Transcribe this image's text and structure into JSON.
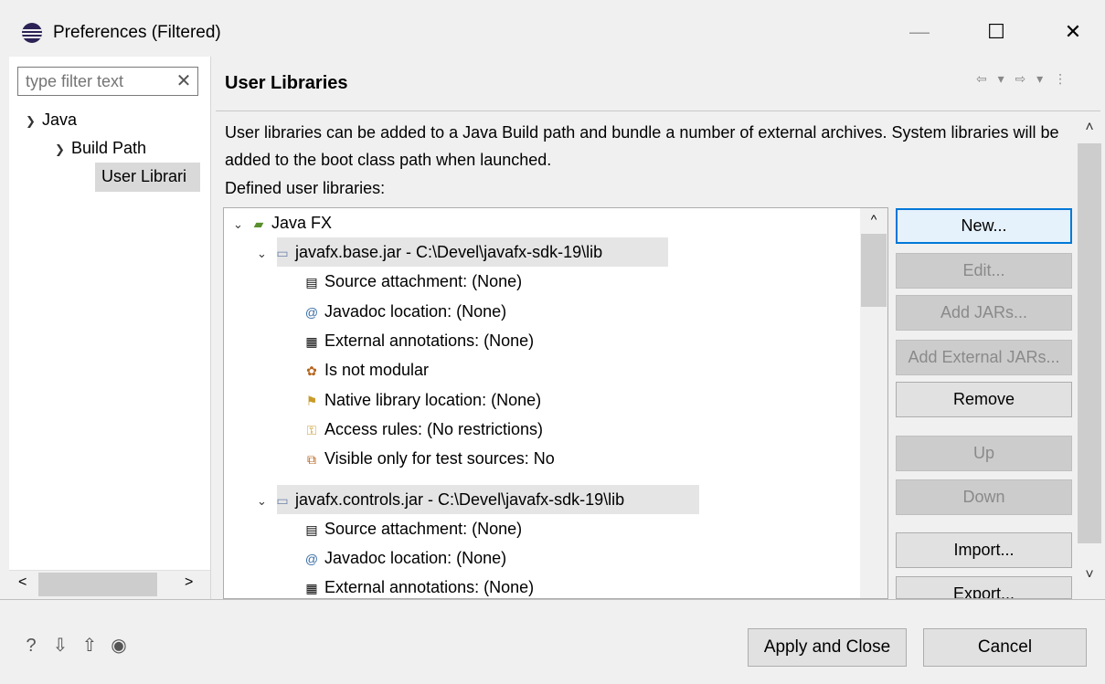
{
  "window": {
    "title": "Preferences (Filtered)",
    "minimize_icon": "—",
    "maximize_icon": "☐",
    "close_icon": "✕"
  },
  "left": {
    "filter_placeholder": "type filter text",
    "tree": [
      {
        "label": "Java"
      },
      {
        "label": "Build Path"
      },
      {
        "label": "User Librari"
      }
    ]
  },
  "page": {
    "title": "User Libraries",
    "description": "User libraries can be added to a Java Build path and bundle a number of external archives. System libraries will be added to the boot class path when launched.",
    "defined_label": "Defined user libraries:"
  },
  "libraries": {
    "root": "Java FX",
    "jars": [
      {
        "label": "javafx.base.jar - C:\\Devel\\javafx-sdk-19\\lib",
        "children": [
          {
            "icon": "source-attachment-icon",
            "label": "Source attachment: (None)"
          },
          {
            "icon": "javadoc-icon",
            "label": "Javadoc location: (None)"
          },
          {
            "icon": "annotations-icon",
            "label": "External annotations: (None)"
          },
          {
            "icon": "modular-icon",
            "label": "Is not modular"
          },
          {
            "icon": "native-library-icon",
            "label": "Native library location: (None)"
          },
          {
            "icon": "access-rules-icon",
            "label": "Access rules: (No restrictions)"
          },
          {
            "icon": "test-sources-icon",
            "label": "Visible only for test sources: No"
          }
        ]
      },
      {
        "label": "javafx.controls.jar - C:\\Devel\\javafx-sdk-19\\lib",
        "children": [
          {
            "icon": "source-attachment-icon",
            "label": "Source attachment: (None)"
          },
          {
            "icon": "javadoc-icon",
            "label": "Javadoc location: (None)"
          },
          {
            "icon": "annotations-icon",
            "label": "External annotations: (None)"
          }
        ]
      }
    ]
  },
  "buttons": {
    "new": "New...",
    "edit": "Edit...",
    "add_jars": "Add JARs...",
    "add_external_jars": "Add External JARs...",
    "remove": "Remove",
    "up": "Up",
    "down": "Down",
    "import": "Import...",
    "export": "Export..."
  },
  "footer": {
    "apply_close": "Apply and Close",
    "cancel": "Cancel"
  }
}
